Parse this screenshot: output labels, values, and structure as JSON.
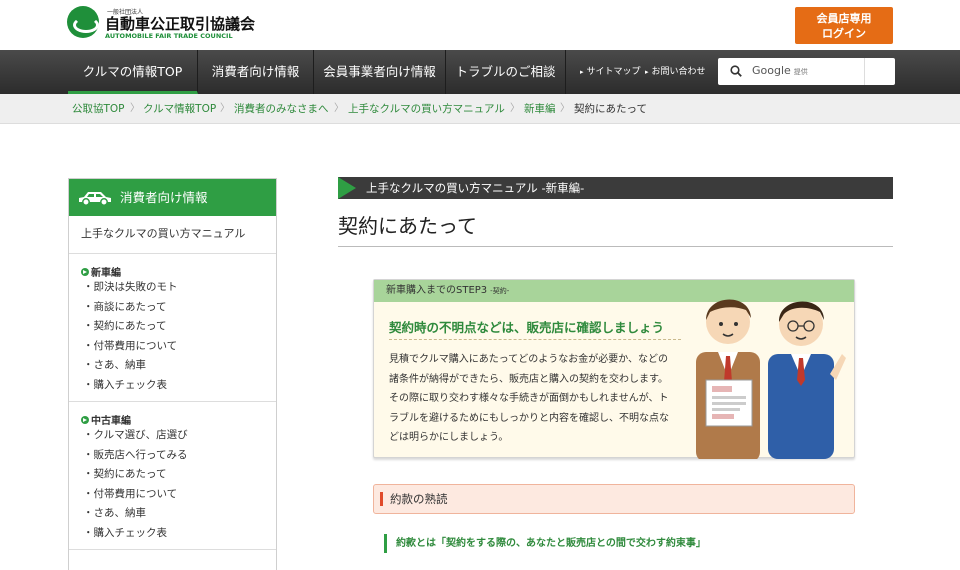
{
  "header": {
    "logo_small": "一般社団法人",
    "logo_name": "自動車公正取引協議会",
    "logo_en": "AUTOMOBILE FAIR TRADE COUNCIL",
    "member_btn_line1": "会員店専用",
    "member_btn_line2": "ログイン"
  },
  "nav": {
    "items": [
      "クルマの情報TOP",
      "消費者向け情報",
      "会員事業者向け情報",
      "トラブルのご相談"
    ],
    "sitemap": "サイトマップ",
    "contact": "お問い合わせ",
    "search_brand": "Google",
    "search_brand_sub": "提供"
  },
  "breadcrumb": [
    "公取協TOP",
    "クルマ情報TOP",
    "消費者のみなさまへ",
    "上手なクルマの買い方マニュアル",
    "新車編",
    "契約にあたって"
  ],
  "sidebar": {
    "header": "消費者向け情報",
    "link": "上手なクルマの買い方マニュアル",
    "sections": [
      {
        "title": "新車編",
        "items": [
          "即決は失敗のモト",
          "商談にあたって",
          "契約にあたって",
          "付帯費用について",
          "さあ、納車",
          "購入チェック表"
        ]
      },
      {
        "title": "中古車編",
        "items": [
          "クルマ選び、店選び",
          "販売店へ行ってみる",
          "契約にあたって",
          "付帯費用について",
          "さあ、納車",
          "購入チェック表"
        ]
      }
    ]
  },
  "main": {
    "section_bar": "上手なクルマの買い方マニュアル -新車編-",
    "title": "契約にあたって",
    "step_head": "新車購入までのSTEP3",
    "step_head_sub": "-契約-",
    "step_title": "契約時の不明点などは、販売店に確認しましょう",
    "step_body": "見積でクルマ購入にあたってどのようなお金が必要か、などの諸条件が納得ができたら、販売店と購入の契約を交わします。その際に取り交わす様々な手続きが面倒かもしれませんが、トラブルを避けるためにもしっかりと内容を確認し、不明な点などは明らかにしましょう。",
    "clause_title": "約款の熟読",
    "note": "約款とは「契約をする際の、あなたと販売店との間で交わす約束事」"
  },
  "colors": {
    "brand_green": "#2f9e44",
    "accent_orange": "#e56c15",
    "nav_dark": "#3b3b3b"
  }
}
